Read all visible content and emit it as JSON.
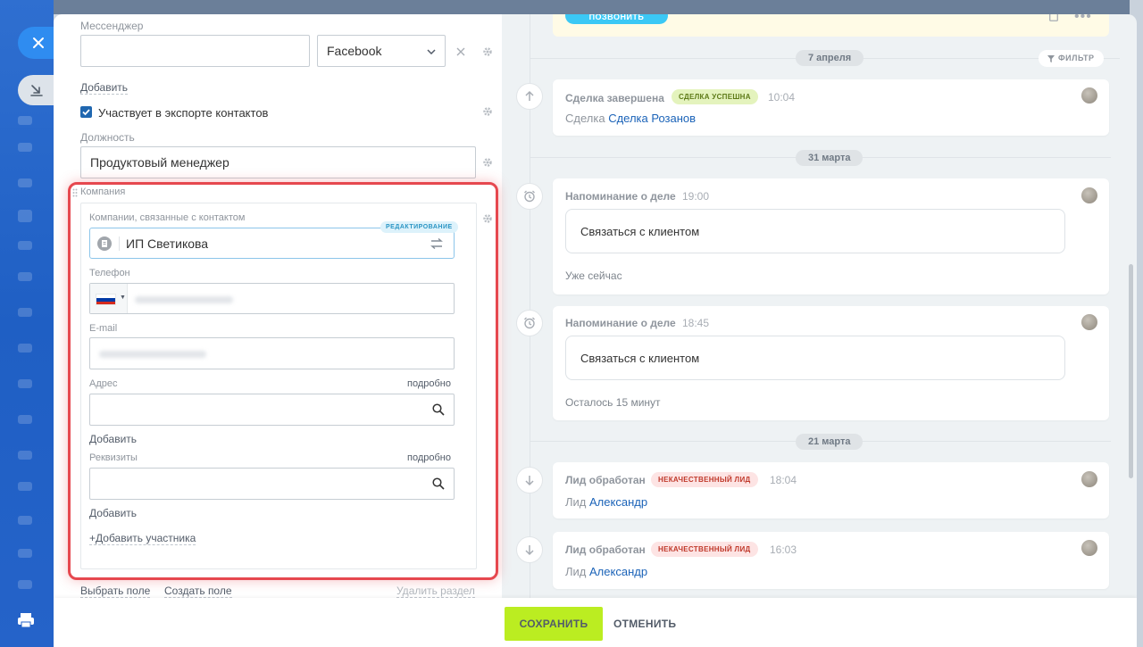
{
  "window": {
    "close_icon": "close-icon",
    "side_icon": "collapse-icon",
    "print_icon": "print-icon"
  },
  "form": {
    "messenger": {
      "label": "Мессенджер",
      "value": "",
      "type_value": "Facebook"
    },
    "add_link": "Добавить",
    "export_checkbox": {
      "label": "Участвует в экспорте контактов",
      "checked": true
    },
    "position": {
      "label": "Должность",
      "value": "Продуктовый менеджер"
    },
    "company_section": {
      "title": "Компания",
      "related_label": "Компании, связанные с контактом",
      "edit_badge": "РЕДАКТИРОВАНИЕ",
      "company_name": "ИП Светикова",
      "phone_label": "Телефон",
      "email_label": "E-mail",
      "address_label": "Адрес",
      "address_detail": "подробно",
      "address_add": "Добавить",
      "requisites_label": "Реквизиты",
      "requisites_detail": "подробно",
      "requisites_add": "Добавить",
      "add_participant": "+Добавить участника"
    },
    "footer_links": {
      "choose_field": "Выбрать поле",
      "create_field": "Создать поле",
      "delete_section": "Удалить раздел"
    }
  },
  "bottom_bar": {
    "save_label": "СОХРАНИТЬ",
    "cancel_label": "ОТМЕНИТЬ"
  },
  "timeline": {
    "call_button": "ПОЗВОНИТЬ",
    "filter_label": "ФИЛЬТР",
    "dates": [
      "7 апреля",
      "31 марта",
      "21 марта"
    ],
    "items": [
      {
        "title": "Сделка завершена",
        "tag": "СДЕЛКА УСПЕШНА",
        "time": "10:04",
        "line_prefix": "Сделка",
        "line_link": "Сделка Розанов"
      },
      {
        "title": "Напоминание о деле",
        "time": "19:00",
        "note": "Связаться с клиентом",
        "foot": "Уже сейчас"
      },
      {
        "title": "Напоминание о деле",
        "time": "18:45",
        "note": "Связаться с клиентом",
        "foot": "Осталось 15 минут"
      },
      {
        "title": "Лид обработан",
        "tag": "НЕКАЧЕСТВЕННЫЙ ЛИД",
        "time": "18:04",
        "line_prefix": "Лид",
        "line_link": "Александр"
      },
      {
        "title": "Лид обработан",
        "tag": "НЕКАЧЕСТВЕННЫЙ ЛИД",
        "time": "16:03",
        "line_prefix": "Лид",
        "line_link": "Александр"
      }
    ]
  },
  "colors": {
    "accent_save": "#bbed21",
    "highlight_border": "#e6484f",
    "link": "#1b63b8",
    "call_button": "#3bc8f5"
  }
}
